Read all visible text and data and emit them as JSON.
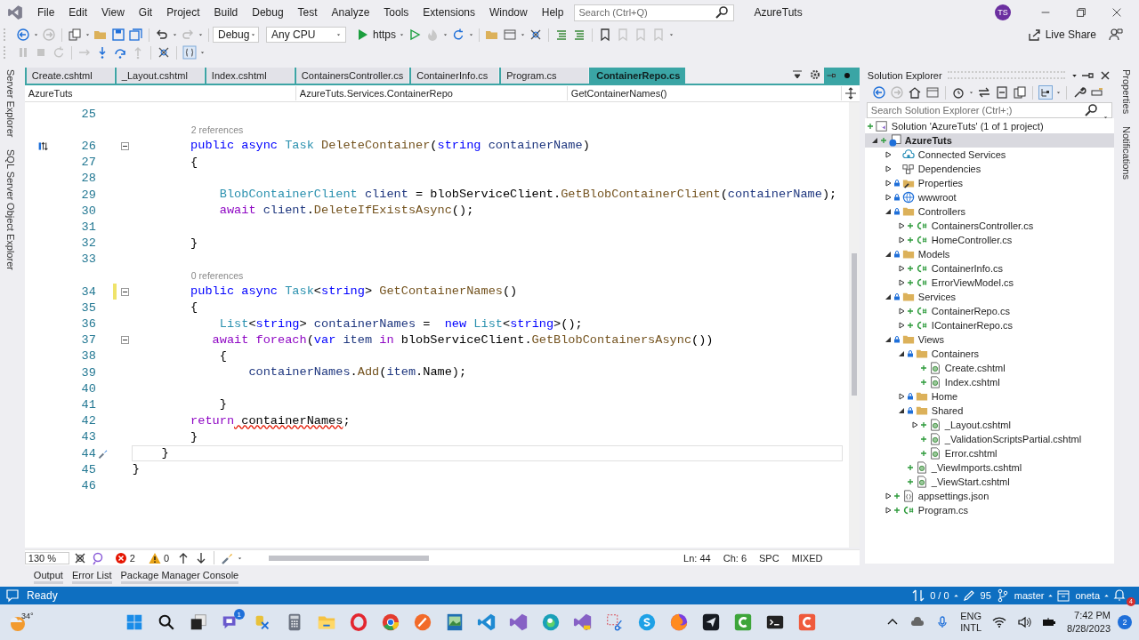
{
  "title_bar": {
    "menu": [
      "File",
      "Edit",
      "View",
      "Git",
      "Project",
      "Build",
      "Debug",
      "Test",
      "Analyze",
      "Tools",
      "Extensions",
      "Window",
      "Help"
    ],
    "search": {
      "placeholder": "Search (Ctrl+Q)"
    },
    "solution_name": "AzureTuts",
    "avatar": "TS"
  },
  "toolbar": {
    "configuration": "Debug",
    "platform": "Any CPU",
    "run_target": "https",
    "live_share": "Live Share"
  },
  "side_tabs_left": [
    "Server Explorer",
    "SQL Server Object Explorer"
  ],
  "side_tabs_right": [
    "Properties",
    "Notifications"
  ],
  "editor": {
    "tabs": [
      {
        "label": "Create.cshtml",
        "selected": false,
        "modified": false
      },
      {
        "label": "_Layout.cshtml",
        "selected": false,
        "modified": false
      },
      {
        "label": "Index.cshtml",
        "selected": false,
        "modified": false
      },
      {
        "label": "ContainersController.cs",
        "selected": false,
        "modified": false
      },
      {
        "label": "ContainerInfo.cs",
        "selected": false,
        "modified": false
      },
      {
        "label": "Program.cs",
        "selected": false,
        "modified": false
      },
      {
        "label": "ContainerRepo.cs",
        "selected": true,
        "modified": true
      }
    ],
    "nav": [
      "AzureTuts",
      "AzureTuts.Services.ContainerRepo",
      "GetContainerNames()"
    ],
    "lines": [
      {
        "kind": "code",
        "number": "25",
        "fold": false,
        "changed": false,
        "current": false,
        "codelens_icon": false,
        "quick_action": false
      },
      {
        "kind": "codelens",
        "text": "2 references"
      },
      {
        "kind": "code",
        "number": "26",
        "fold": true,
        "changed": false,
        "current": false,
        "codelens_icon": true,
        "quick_action": false,
        "tokens": [
          {
            "text": "        public",
            "kind": "kw"
          },
          {
            "text": " async",
            "kind": "kw"
          },
          {
            "text": " Task",
            "kind": "type"
          },
          {
            "text": " DeleteContainer",
            "kind": "method"
          },
          {
            "text": "(",
            "kind": "plain"
          },
          {
            "text": "string",
            "kind": "kw"
          },
          {
            "text": " containerName",
            "kind": "param"
          },
          {
            "text": ")",
            "kind": "plain"
          }
        ]
      },
      {
        "kind": "code",
        "number": "27",
        "fold": false,
        "changed": false,
        "current": false,
        "codelens_icon": false,
        "quick_action": false,
        "tokens": [
          {
            "text": "        {",
            "kind": "plain"
          }
        ]
      },
      {
        "kind": "code",
        "number": "28",
        "fold": false,
        "changed": false,
        "current": false,
        "codelens_icon": false,
        "quick_action": false
      },
      {
        "kind": "code",
        "number": "29",
        "fold": false,
        "changed": false,
        "current": false,
        "codelens_icon": false,
        "quick_action": false,
        "tokens": [
          {
            "text": "            BlobContainerClient",
            "kind": "type"
          },
          {
            "text": " client",
            "kind": "param"
          },
          {
            "text": " = blobServiceClient.",
            "kind": "plain"
          },
          {
            "text": "GetBlobContainerClient",
            "kind": "method"
          },
          {
            "text": "(",
            "kind": "plain"
          },
          {
            "text": "containerName",
            "kind": "param"
          },
          {
            "text": ");",
            "kind": "plain"
          }
        ]
      },
      {
        "kind": "code",
        "number": "30",
        "fold": false,
        "changed": false,
        "current": false,
        "codelens_icon": false,
        "quick_action": false,
        "tokens": [
          {
            "text": "            await",
            "kind": "ctrl"
          },
          {
            "text": " client",
            "kind": "param"
          },
          {
            "text": ".",
            "kind": "plain"
          },
          {
            "text": "DeleteIfExistsAsync",
            "kind": "method"
          },
          {
            "text": "();",
            "kind": "plain"
          }
        ]
      },
      {
        "kind": "code",
        "number": "31",
        "fold": false,
        "changed": false,
        "current": false,
        "codelens_icon": false,
        "quick_action": false
      },
      {
        "kind": "code",
        "number": "32",
        "fold": false,
        "changed": false,
        "current": false,
        "codelens_icon": false,
        "quick_action": false,
        "tokens": [
          {
            "text": "        }",
            "kind": "plain"
          }
        ]
      },
      {
        "kind": "code",
        "number": "33",
        "fold": false,
        "changed": false,
        "current": false,
        "codelens_icon": false,
        "quick_action": false
      },
      {
        "kind": "codelens",
        "text": "0 references"
      },
      {
        "kind": "code",
        "number": "34",
        "fold": true,
        "changed": true,
        "current": false,
        "codelens_icon": false,
        "quick_action": false,
        "tokens": [
          {
            "text": "        public",
            "kind": "kw"
          },
          {
            "text": " async",
            "kind": "kw"
          },
          {
            "text": " Task",
            "kind": "type"
          },
          {
            "text": "<",
            "kind": "plain"
          },
          {
            "text": "string",
            "kind": "kw"
          },
          {
            "text": "> ",
            "kind": "plain"
          },
          {
            "text": "GetContainerNames",
            "kind": "method"
          },
          {
            "text": "()",
            "kind": "plain"
          }
        ]
      },
      {
        "kind": "code",
        "number": "35",
        "fold": false,
        "changed": false,
        "current": false,
        "codelens_icon": false,
        "quick_action": false,
        "tokens": [
          {
            "text": "        {",
            "kind": "plain"
          }
        ]
      },
      {
        "kind": "code",
        "number": "36",
        "fold": false,
        "changed": false,
        "current": false,
        "codelens_icon": false,
        "quick_action": false,
        "tokens": [
          {
            "text": "            List",
            "kind": "type"
          },
          {
            "text": "<",
            "kind": "plain"
          },
          {
            "text": "string",
            "kind": "kw"
          },
          {
            "text": "> ",
            "kind": "plain"
          },
          {
            "text": "containerNames",
            "kind": "param"
          },
          {
            "text": " =  ",
            "kind": "plain"
          },
          {
            "text": "new",
            "kind": "kw"
          },
          {
            "text": " List",
            "kind": "type"
          },
          {
            "text": "<",
            "kind": "plain"
          },
          {
            "text": "string",
            "kind": "kw"
          },
          {
            "text": ">();",
            "kind": "plain"
          }
        ]
      },
      {
        "kind": "code",
        "number": "37",
        "fold": true,
        "changed": false,
        "current": false,
        "codelens_icon": false,
        "quick_action": false,
        "tokens": [
          {
            "text": "           await",
            "kind": "ctrl"
          },
          {
            "text": " foreach",
            "kind": "ctrl"
          },
          {
            "text": "(",
            "kind": "plain"
          },
          {
            "text": "var",
            "kind": "kw"
          },
          {
            "text": " item",
            "kind": "param"
          },
          {
            "text": " in",
            "kind": "ctrl"
          },
          {
            "text": " blobServiceClient.",
            "kind": "plain"
          },
          {
            "text": "GetBlobContainersAsync",
            "kind": "method"
          },
          {
            "text": "())",
            "kind": "plain"
          }
        ]
      },
      {
        "kind": "code",
        "number": "38",
        "fold": false,
        "changed": false,
        "current": false,
        "codelens_icon": false,
        "quick_action": false,
        "tokens": [
          {
            "text": "            {",
            "kind": "plain"
          }
        ]
      },
      {
        "kind": "code",
        "number": "39",
        "fold": false,
        "changed": false,
        "current": false,
        "codelens_icon": false,
        "quick_action": false,
        "tokens": [
          {
            "text": "                containerNames",
            "kind": "param"
          },
          {
            "text": ".",
            "kind": "plain"
          },
          {
            "text": "Add",
            "kind": "method"
          },
          {
            "text": "(",
            "kind": "plain"
          },
          {
            "text": "item",
            "kind": "param"
          },
          {
            "text": ".Name);",
            "kind": "plain"
          }
        ]
      },
      {
        "kind": "code",
        "number": "40",
        "fold": false,
        "changed": false,
        "current": false,
        "codelens_icon": false,
        "quick_action": false
      },
      {
        "kind": "code",
        "number": "41",
        "fold": false,
        "changed": false,
        "current": false,
        "codelens_icon": false,
        "quick_action": false,
        "tokens": [
          {
            "text": "            }",
            "kind": "plain"
          }
        ]
      },
      {
        "kind": "code",
        "number": "42",
        "fold": false,
        "changed": false,
        "current": false,
        "codelens_icon": false,
        "quick_action": false,
        "tokens": [
          {
            "text": "        return",
            "kind": "ctrl"
          },
          {
            "text": " containerNames",
            "kind": "error"
          },
          {
            "text": ";",
            "kind": "plain"
          }
        ]
      },
      {
        "kind": "code",
        "number": "43",
        "fold": false,
        "changed": false,
        "current": false,
        "codelens_icon": false,
        "quick_action": false,
        "tokens": [
          {
            "text": "        }",
            "kind": "plain"
          }
        ]
      },
      {
        "kind": "code",
        "number": "44",
        "fold": false,
        "changed": false,
        "current": true,
        "codelens_icon": false,
        "quick_action": true,
        "tokens": [
          {
            "text": "    }",
            "kind": "plain"
          }
        ]
      },
      {
        "kind": "code",
        "number": "45",
        "fold": false,
        "changed": false,
        "current": false,
        "codelens_icon": false,
        "quick_action": false,
        "tokens": [
          {
            "text": "}",
            "kind": "plain"
          }
        ]
      },
      {
        "kind": "code",
        "number": "46",
        "fold": false,
        "changed": false,
        "current": false,
        "codelens_icon": false,
        "quick_action": false
      }
    ],
    "zoom": "130 %",
    "errors": "2",
    "warnings": "0",
    "position": [
      "Ln: 44",
      "Ch: 6",
      "SPC",
      "MIXED"
    ]
  },
  "bottom_tabs": [
    "Output",
    "Error List",
    "Package Manager Console"
  ],
  "solution_explorer": {
    "title": "Solution Explorer",
    "search": {
      "placeholder": "Search Solution Explorer (Ctrl+;)"
    },
    "tree": [
      {
        "label": "Solution 'AzureTuts' (1 of 1 project)",
        "kind": "solution",
        "added": true,
        "locked": false,
        "expandable": false,
        "selected": false,
        "children": [
          {
            "label": "AzureTuts",
            "kind": "project",
            "added": true,
            "locked": false,
            "expandable": true,
            "expanded": true,
            "selected": true,
            "children": [
              {
                "label": "Connected Services",
                "kind": "connected",
                "added": false,
                "locked": false,
                "expandable": true,
                "expanded": false,
                "selected": false
              },
              {
                "label": "Dependencies",
                "kind": "dependencies",
                "added": false,
                "locked": false,
                "expandable": true,
                "expanded": false,
                "selected": false
              },
              {
                "label": "Properties",
                "kind": "properties",
                "added": false,
                "locked": true,
                "expandable": true,
                "expanded": false,
                "selected": false
              },
              {
                "label": "wwwroot",
                "kind": "web",
                "added": false,
                "locked": true,
                "expandable": true,
                "expanded": false,
                "selected": false
              },
              {
                "label": "Controllers",
                "kind": "folder",
                "added": false,
                "locked": true,
                "expandable": true,
                "expanded": true,
                "selected": false,
                "children": [
                  {
                    "label": "ContainersController.cs",
                    "kind": "cs",
                    "added": true,
                    "locked": false,
                    "expandable": true,
                    "expanded": false,
                    "selected": false
                  },
                  {
                    "label": "HomeController.cs",
                    "kind": "cs",
                    "added": true,
                    "locked": false,
                    "expandable": true,
                    "expanded": false,
                    "selected": false
                  }
                ]
              },
              {
                "label": "Models",
                "kind": "folder",
                "added": false,
                "locked": true,
                "expandable": true,
                "expanded": true,
                "selected": false,
                "children": [
                  {
                    "label": "ContainerInfo.cs",
                    "kind": "cs",
                    "added": true,
                    "locked": false,
                    "expandable": true,
                    "expanded": false,
                    "selected": false
                  },
                  {
                    "label": "ErrorViewModel.cs",
                    "kind": "cs",
                    "added": true,
                    "locked": false,
                    "expandable": true,
                    "expanded": false,
                    "selected": false
                  }
                ]
              },
              {
                "label": "Services",
                "kind": "folder",
                "added": false,
                "locked": true,
                "expandable": true,
                "expanded": true,
                "selected": false,
                "children": [
                  {
                    "label": "ContainerRepo.cs",
                    "kind": "cs",
                    "added": true,
                    "locked": false,
                    "expandable": true,
                    "expanded": false,
                    "selected": false
                  },
                  {
                    "label": "IContainerRepo.cs",
                    "kind": "cs",
                    "added": true,
                    "locked": false,
                    "expandable": true,
                    "expanded": false,
                    "selected": false
                  }
                ]
              },
              {
                "label": "Views",
                "kind": "folder",
                "added": false,
                "locked": true,
                "expandable": true,
                "expanded": true,
                "selected": false,
                "children": [
                  {
                    "label": "Containers",
                    "kind": "folder",
                    "added": false,
                    "locked": true,
                    "expandable": true,
                    "expanded": true,
                    "selected": false,
                    "children": [
                      {
                        "label": "Create.cshtml",
                        "kind": "cshtml",
                        "added": true,
                        "locked": false,
                        "expandable": false,
                        "selected": false
                      },
                      {
                        "label": "Index.cshtml",
                        "kind": "cshtml",
                        "added": true,
                        "locked": false,
                        "expandable": false,
                        "selected": false
                      }
                    ]
                  },
                  {
                    "label": "Home",
                    "kind": "folder",
                    "added": false,
                    "locked": true,
                    "expandable": true,
                    "expanded": false,
                    "selected": false
                  },
                  {
                    "label": "Shared",
                    "kind": "folder",
                    "added": false,
                    "locked": true,
                    "expandable": true,
                    "expanded": true,
                    "selected": false,
                    "children": [
                      {
                        "label": "_Layout.cshtml",
                        "kind": "cshtml",
                        "added": true,
                        "locked": false,
                        "expandable": true,
                        "expanded": false,
                        "selected": false
                      },
                      {
                        "label": "_ValidationScriptsPartial.cshtml",
                        "kind": "cshtml",
                        "added": true,
                        "locked": false,
                        "expandable": false,
                        "selected": false
                      },
                      {
                        "label": "Error.cshtml",
                        "kind": "cshtml",
                        "added": true,
                        "locked": false,
                        "expandable": false,
                        "selected": false
                      }
                    ]
                  },
                  {
                    "label": "_ViewImports.cshtml",
                    "kind": "cshtml",
                    "added": true,
                    "locked": false,
                    "expandable": false,
                    "selected": false
                  },
                  {
                    "label": "_ViewStart.cshtml",
                    "kind": "cshtml",
                    "added": true,
                    "locked": false,
                    "expandable": false,
                    "selected": false
                  }
                ]
              },
              {
                "label": "appsettings.json",
                "kind": "json",
                "added": true,
                "locked": false,
                "expandable": true,
                "expanded": false,
                "selected": false
              },
              {
                "label": "Program.cs",
                "kind": "cs",
                "added": true,
                "locked": false,
                "expandable": true,
                "expanded": false,
                "selected": false
              }
            ]
          }
        ]
      }
    ]
  },
  "status_bar": {
    "message": "Ready",
    "sync": "0 / 0",
    "edits": "95",
    "branch": "master",
    "repo": "oneta",
    "notifications": "4"
  },
  "taskbar": {
    "weather": "34°",
    "chat_badge": "1",
    "language": [
      "ENG",
      "INTL"
    ],
    "time": "7:42 PM",
    "date": "8/28/2023",
    "notification_count": "2"
  }
}
